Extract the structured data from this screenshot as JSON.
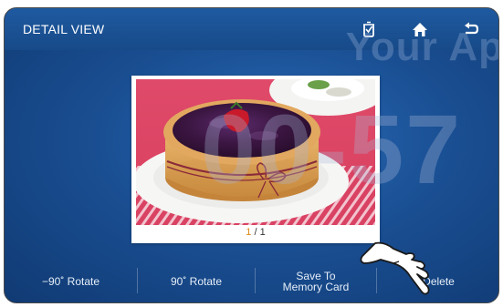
{
  "header": {
    "title": "DETAIL VIEW",
    "icons": [
      "gallery-icon",
      "home-icon",
      "back-icon"
    ]
  },
  "watermark": {
    "top_text": "Your Ap",
    "mid_text": "00-57"
  },
  "photo": {
    "subject": "blueberry tart",
    "counter_current": "1",
    "counter_sep": " / ",
    "counter_total": "1"
  },
  "bottom_buttons": [
    {
      "label": "−90˚ Rotate"
    },
    {
      "label": "90˚ Rotate"
    },
    {
      "label": "Save To\nMemory Card"
    },
    {
      "label": "Delete"
    }
  ],
  "colors": {
    "background": "#1a4f93",
    "titlebar": "#1f5aa1",
    "counter_current": "#e08a1a"
  }
}
